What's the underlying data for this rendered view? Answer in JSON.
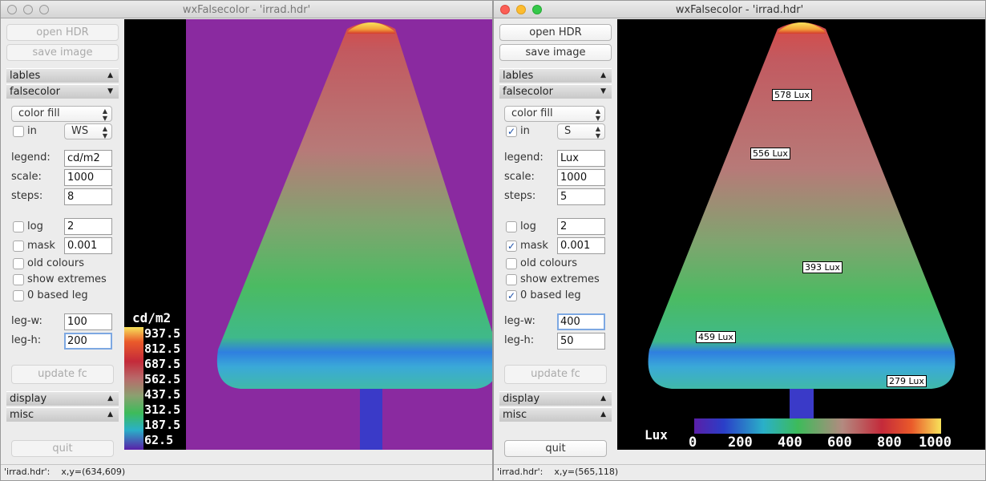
{
  "windows": [
    {
      "title": "wxFalsecolor - 'irrad.hdr'",
      "active": false,
      "buttons": {
        "open": "open HDR",
        "save": "save image",
        "update": "update fc",
        "quit": "quit"
      },
      "sections": {
        "labels": "lables",
        "falsecolor": "falsecolor",
        "display": "display",
        "misc": "misc"
      },
      "mode_select": "color fill",
      "in_checked": false,
      "in_label": "in",
      "unit_select": "WS",
      "legend_label": "legend:",
      "legend_value": "cd/m2",
      "scale_label": "scale:",
      "scale_value": "1000",
      "steps_label": "steps:",
      "steps_value": "8",
      "log_label": "log",
      "log_checked": false,
      "log_value": "2",
      "mask_label": "mask",
      "mask_checked": false,
      "mask_value": "0.001",
      "old_colours_label": "old colours",
      "old_colours_checked": false,
      "show_extremes_label": "show extremes",
      "show_extremes_checked": false,
      "zero_based_label": "0 based leg",
      "zero_based_checked": false,
      "legw_label": "leg-w:",
      "legw_value": "100",
      "legh_label": "leg-h:",
      "legh_value": "200",
      "status": "'irrad.hdr':    x,y=(634,609)",
      "legend": {
        "unit": "cd/m2",
        "values": [
          "937.5",
          "812.5",
          "687.5",
          "562.5",
          "437.5",
          "312.5",
          "187.5",
          "62.5"
        ]
      }
    },
    {
      "title": "wxFalsecolor - 'irrad.hdr'",
      "active": true,
      "buttons": {
        "open": "open HDR",
        "save": "save image",
        "update": "update fc",
        "quit": "quit"
      },
      "sections": {
        "labels": "lables",
        "falsecolor": "falsecolor",
        "display": "display",
        "misc": "misc"
      },
      "mode_select": "color fill",
      "in_checked": true,
      "in_label": "in",
      "unit_select": "S",
      "legend_label": "legend:",
      "legend_value": "Lux",
      "scale_label": "scale:",
      "scale_value": "1000",
      "steps_label": "steps:",
      "steps_value": "5",
      "log_label": "log",
      "log_checked": false,
      "log_value": "2",
      "mask_label": "mask",
      "mask_checked": true,
      "mask_value": "0.001",
      "old_colours_label": "old colours",
      "old_colours_checked": false,
      "show_extremes_label": "show extremes",
      "show_extremes_checked": false,
      "zero_based_label": "0 based leg",
      "zero_based_checked": true,
      "legw_label": "leg-w:",
      "legw_value": "400",
      "legh_label": "leg-h:",
      "legh_value": "50",
      "status": "'irrad.hdr':    x,y=(565,118)",
      "legend": {
        "unit": "Lux",
        "values": [
          "0",
          "200",
          "400",
          "600",
          "800",
          "1000"
        ]
      },
      "labels": [
        "578 Lux",
        "556 Lux",
        "393 Lux",
        "459 Lux",
        "279 Lux"
      ]
    }
  ],
  "colors": {
    "purple_bg": "#8a2aa0",
    "legend_low": "#5a1fa8",
    "legend_mid": "#3dbb5a",
    "legend_high": "#f7e25a"
  }
}
